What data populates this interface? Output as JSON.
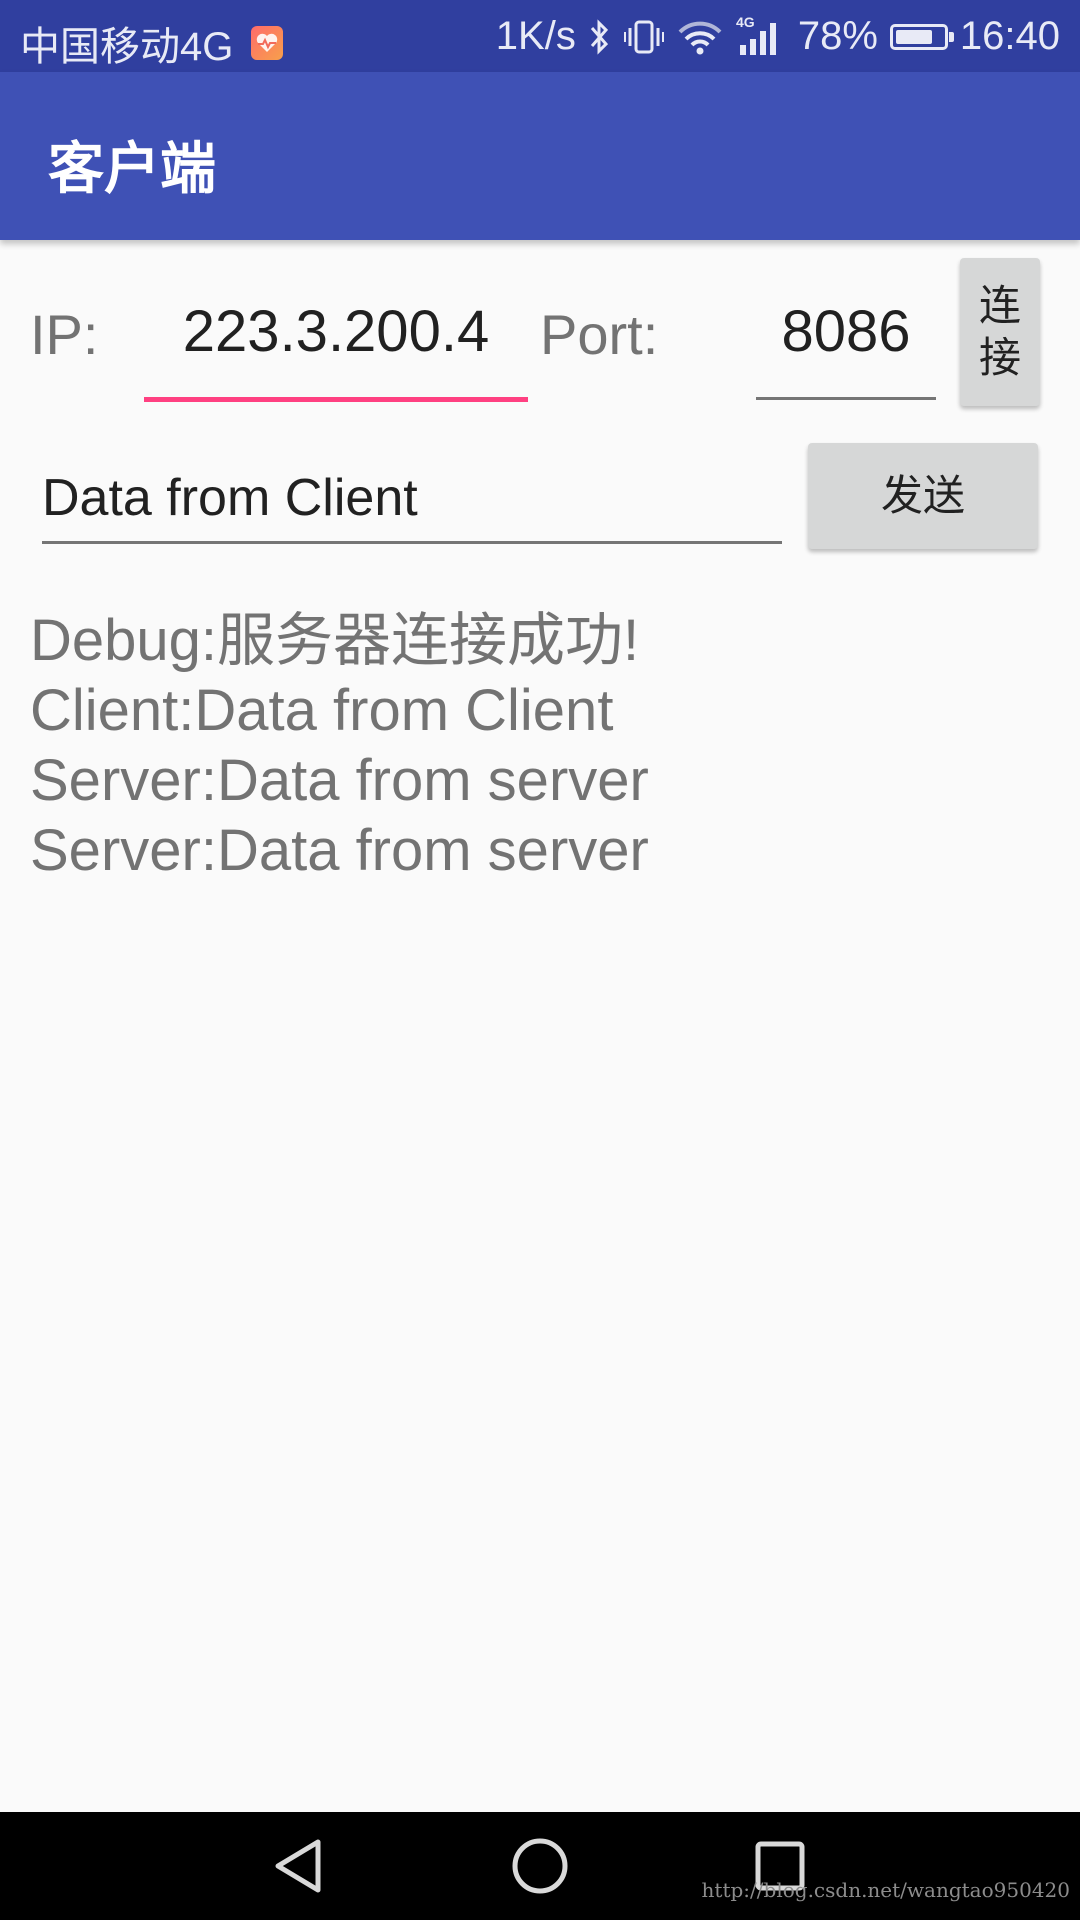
{
  "status_bar": {
    "carrier": "中国移动4G",
    "net_speed": "1K/s",
    "signal_type": "4G",
    "battery_percent": "78%",
    "battery_level": 0.78,
    "time": "16:40",
    "icons": [
      "health-app-icon",
      "bluetooth-icon",
      "vibrate-icon",
      "wifi-icon",
      "cellular-signal-icon",
      "battery-icon"
    ]
  },
  "app_bar": {
    "title": "客户端",
    "color": "#3f51b5"
  },
  "form": {
    "ip_label": "IP:",
    "ip_value": "223.3.200.4",
    "port_label": "Port:",
    "port_value": "8086",
    "connect_button": [
      "连",
      "接"
    ],
    "data_value": "Data from Client",
    "send_button": "发送",
    "accent_color": "#ff4081"
  },
  "log": [
    "Debug:服务器连接成功!",
    "Client:Data from Client",
    "Server:Data from server",
    "Server:Data from server"
  ],
  "nav_bar": {
    "icons": [
      "back-icon",
      "home-icon",
      "recents-icon"
    ]
  },
  "watermark": "http://blog.csdn.net/wangtao950420"
}
